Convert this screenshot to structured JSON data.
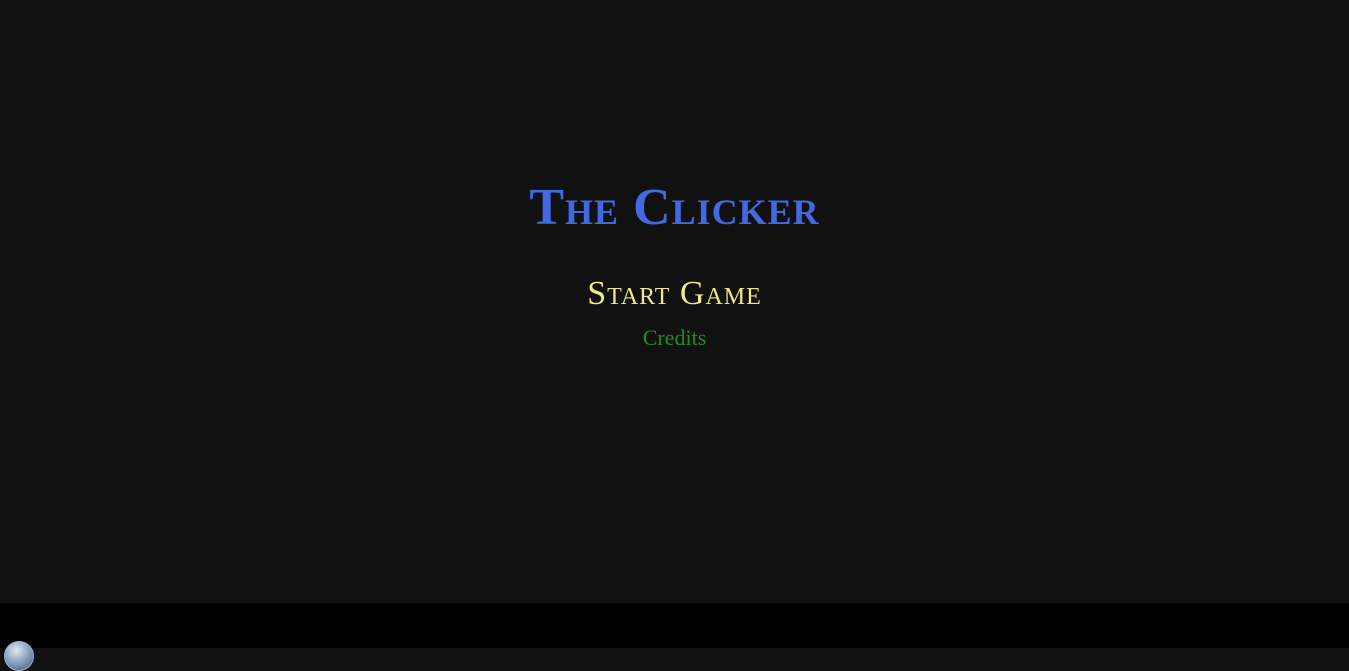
{
  "game": {
    "title": "The Clicker",
    "start_label": "Start Game",
    "credits_label": "Credits"
  },
  "colors": {
    "background": "#111111",
    "title": "#4169e1",
    "start": "#f0e68c",
    "credits": "#228b22",
    "bottom_bar": "#000000"
  },
  "bottom_bar": {
    "icon": "start-orb-icon"
  }
}
